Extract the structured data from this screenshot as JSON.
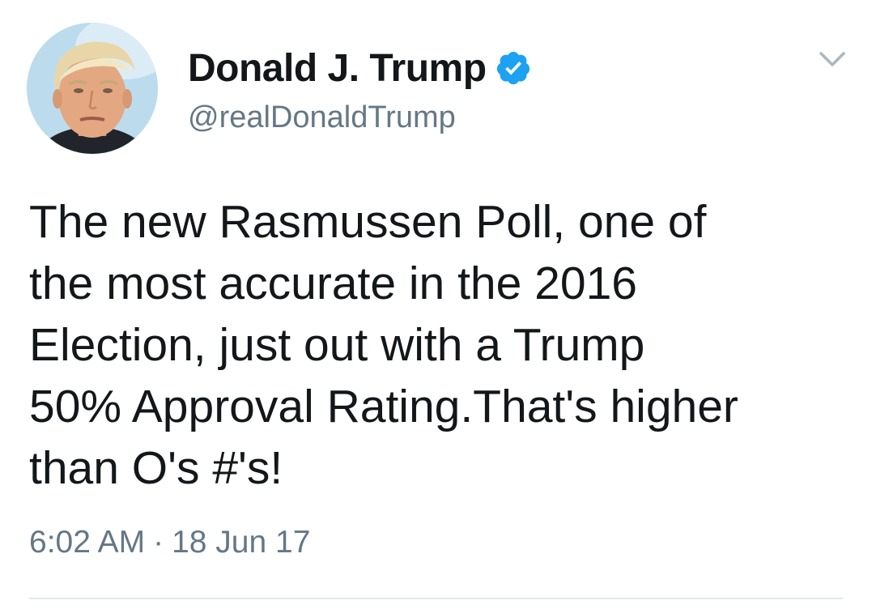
{
  "author": {
    "display_name": "Donald J. Trump",
    "username": "@realDonaldTrump",
    "verified": true,
    "verified_color": "#1da1f2"
  },
  "tweet": {
    "text": "The new Rasmussen Poll, one of\nthe most accurate in the 2016\nElection, just out with a Trump\n50% Approval Rating.That's higher\nthan O's #'s!",
    "time": "6:02 AM",
    "separator": "·",
    "date": "18 Jun 17"
  },
  "icons": {
    "badge": "verified-badge-icon",
    "menu": "chevron-down-icon"
  },
  "colors": {
    "text": "#14171a",
    "secondary": "#657786",
    "divider": "#e1e8ed"
  }
}
